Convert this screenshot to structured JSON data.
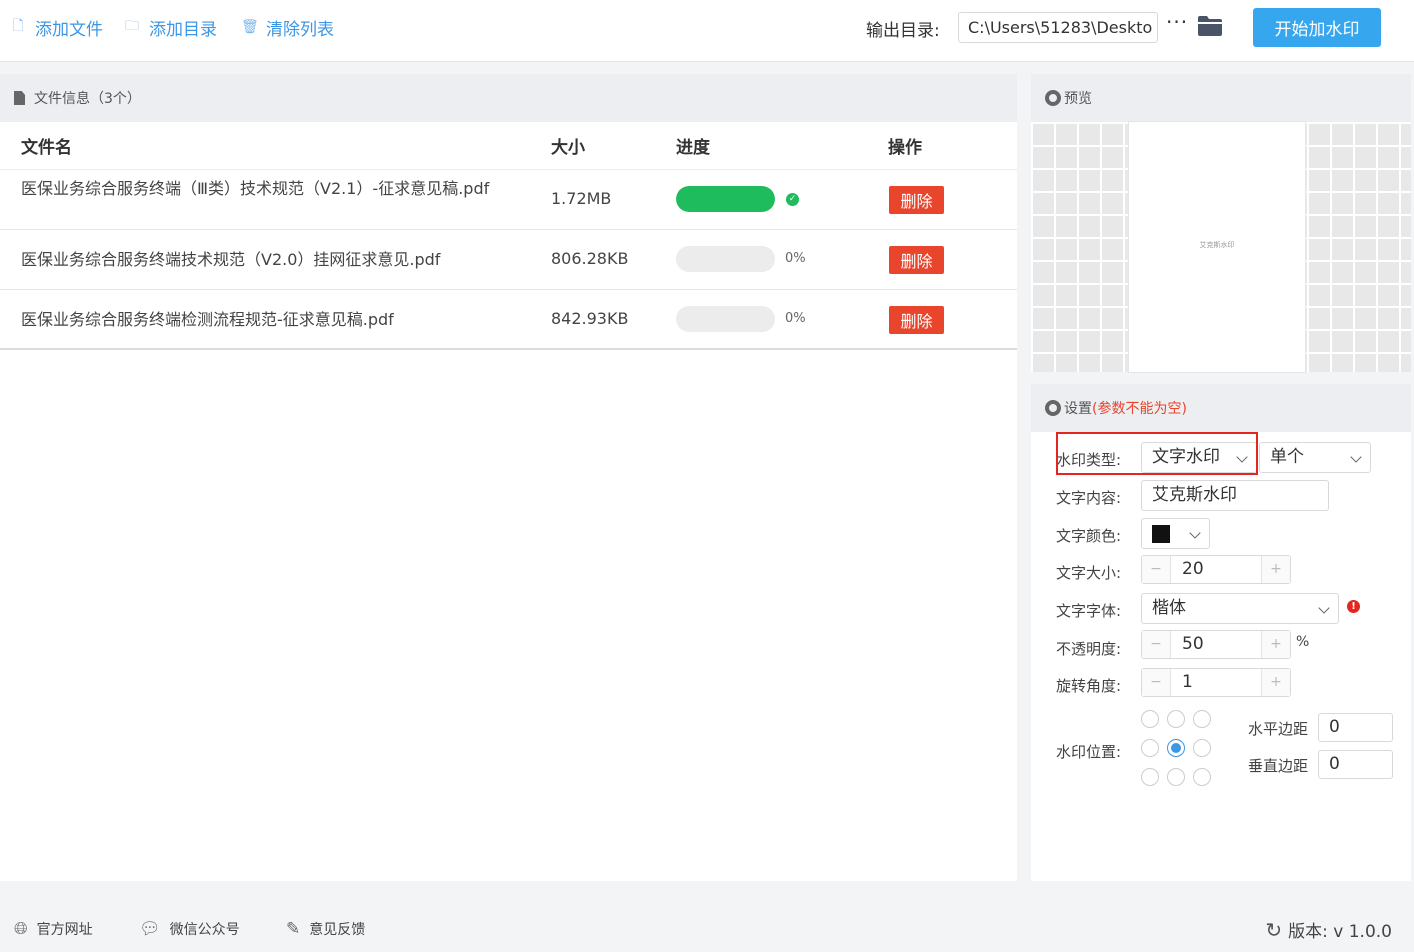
{
  "toolbar": {
    "add_file": "添加文件",
    "add_dir": "添加目录",
    "clear_list": "清除列表",
    "output_label": "输出目录:",
    "output_path": "C:\\Users\\51283\\Deskto",
    "more": "···",
    "start": "开始加水印"
  },
  "files": {
    "header": "文件信息（3个）",
    "columns": {
      "name": "文件名",
      "size": "大小",
      "progress": "进度",
      "action": "操作"
    },
    "rows": [
      {
        "name": "医保业务综合服务终端（Ⅲ类）技术规范（V2.1）-征求意见稿.pdf",
        "size": "1.72MB",
        "progress": 1.0,
        "progress_text": "",
        "delete": "删除"
      },
      {
        "name": "医保业务综合服务终端技术规范（V2.0）挂网征求意见.pdf",
        "size": "806.28KB",
        "progress": 0,
        "progress_text": "0%",
        "delete": "删除"
      },
      {
        "name": "医保业务综合服务终端检测流程规范-征求意见稿.pdf",
        "size": "842.93KB",
        "progress": 0,
        "progress_text": "0%",
        "delete": "删除"
      }
    ]
  },
  "preview": {
    "title": "预览",
    "watermark_text": "艾克斯水印"
  },
  "settings": {
    "title": "设置",
    "warning": "(参数不能为空)",
    "type_label": "水印类型:",
    "type_value": "文字水印",
    "mode_value": "单个",
    "content_label": "文字内容:",
    "content_value": "艾克斯水印",
    "color_label": "文字颜色:",
    "color_value": "#111111",
    "size_label": "文字大小:",
    "size_value": "20",
    "font_label": "文字字体:",
    "font_value": "楷体",
    "opacity_label": "不透明度:",
    "opacity_value": "50",
    "opacity_unit": "%",
    "rotate_label": "旋转角度:",
    "rotate_value": "1",
    "position_label": "水印位置:",
    "position_selected": "center",
    "h_margin_label": "水平边距",
    "h_margin_value": "0",
    "v_margin_label": "垂直边距",
    "v_margin_value": "0"
  },
  "footer": {
    "website": "官方网址",
    "wechat": "微信公众号",
    "feedback": "意见反馈",
    "version": "版本:  v 1.0.0"
  }
}
